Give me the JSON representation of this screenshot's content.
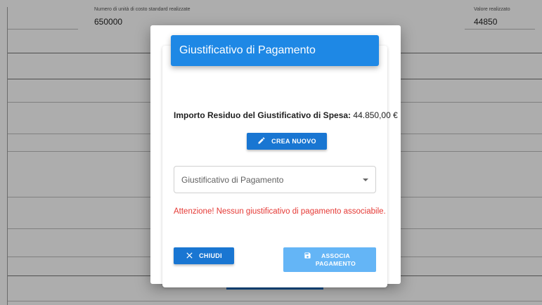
{
  "background": {
    "field_left_label": "Numero di unità di costo standard realizzate",
    "field_left_value": "650000",
    "field_right_label": "Valore realizzato",
    "field_right_value": "44850"
  },
  "modal": {
    "title": "Giustificativo di Pagamento",
    "residuo_label": "Importo Residuo del Giustificativo di Spesa:",
    "residuo_value": "44.850,00 €",
    "crea_nuovo_label": "CREA NUOVO",
    "select_placeholder": "Giustificativo di Pagamento",
    "warning": "Attenzione! Nessun giustificativo di pagamento associabile.",
    "chiudi_label": "CHIUDI",
    "associa_line1": "ASSOCIA",
    "associa_line2": "PAGAMENTO"
  },
  "colors": {
    "primary": "#1976d2",
    "header": "#1e88e5",
    "disabled": "#64b5f6",
    "error": "#e53935"
  },
  "icons": {
    "crea": "pencil-icon",
    "chiudi": "close-icon",
    "associa": "save-icon",
    "select": "caret-down-icon"
  }
}
